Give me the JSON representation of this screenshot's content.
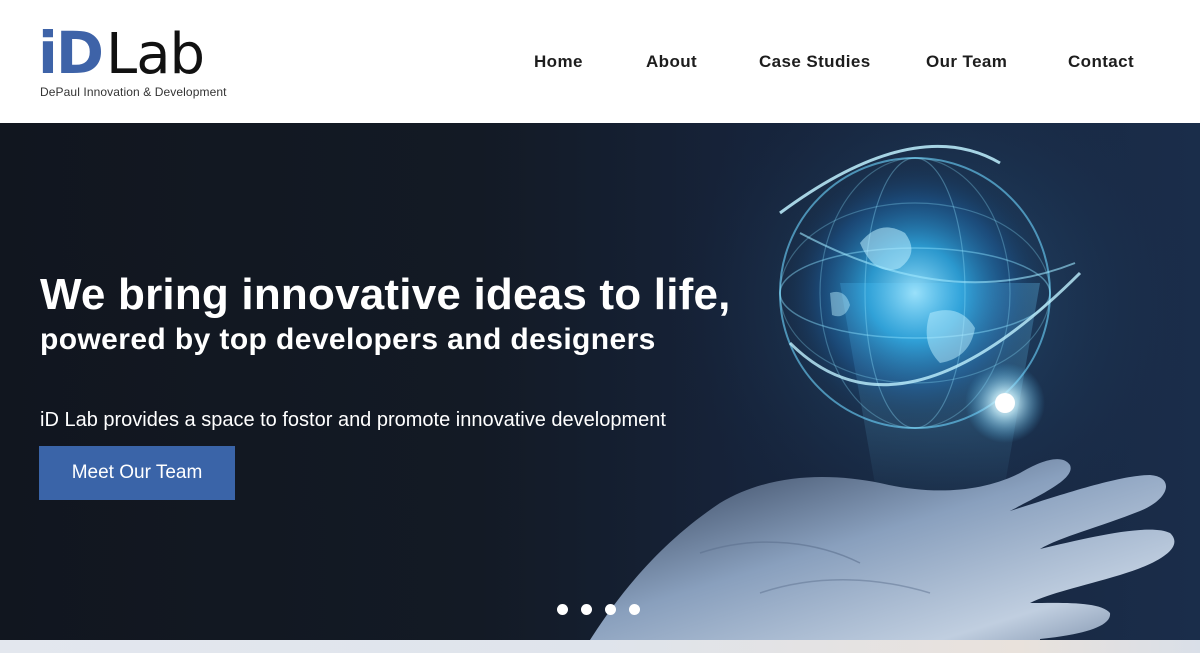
{
  "header": {
    "logo": {
      "mark_id": "iD",
      "mark_lab": "Lab",
      "tagline": "DePaul Innovation & Development",
      "accent_color": "#3e63a8"
    },
    "nav": [
      {
        "label": "Home"
      },
      {
        "label": "About"
      },
      {
        "label": "Case Studies"
      },
      {
        "label": "Our Team"
      },
      {
        "label": "Contact"
      }
    ]
  },
  "hero": {
    "title": "We bring innovative ideas to life,",
    "subtitle": "powered by top developers and designers",
    "description": "iD Lab provides a space to fostor and promote innovative development",
    "cta_label": "Meet Our Team",
    "cta_color": "#3a64a8",
    "image_subject": "glowing-globe-over-hand",
    "carousel": {
      "slide_count": 4
    }
  }
}
